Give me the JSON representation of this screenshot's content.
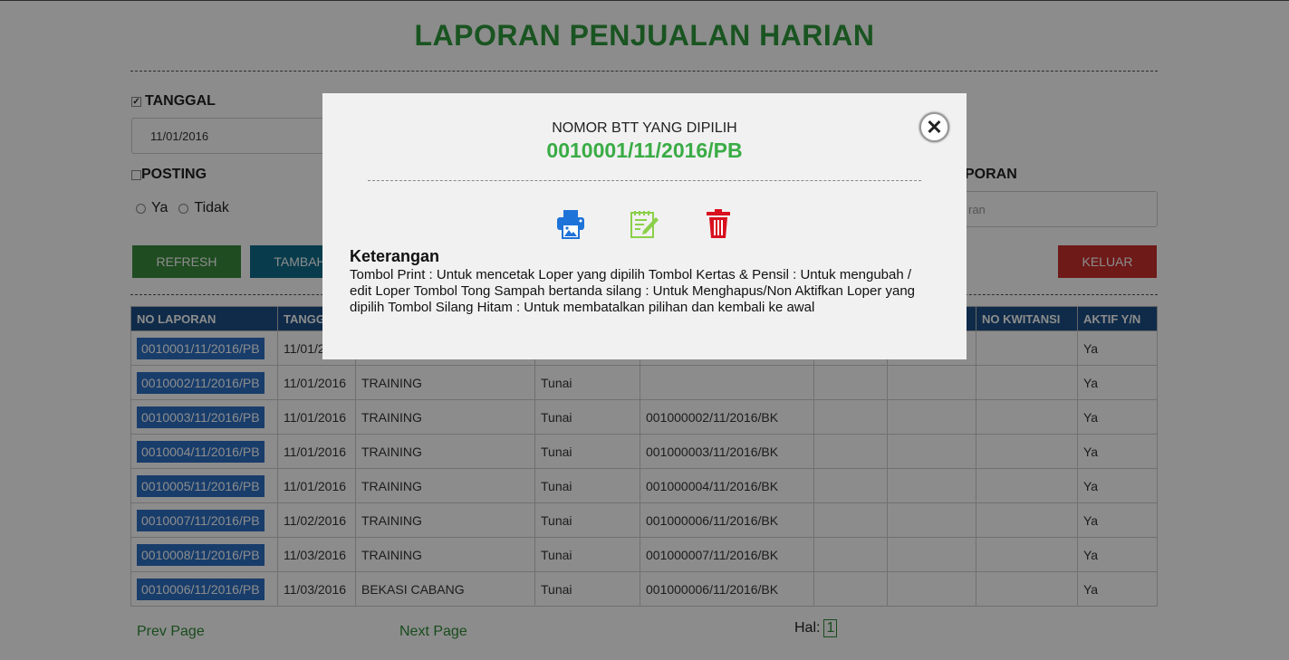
{
  "page": {
    "title": "LAPORAN PENJUALAN HARIAN"
  },
  "filters": {
    "tanggal_label": "TANGGAL",
    "tanggal_checked": true,
    "tanggal_value": "11/01/2016",
    "posting_label": "POSTING",
    "posting_checked": false,
    "radio_ya": "Ya",
    "radio_tidak": "Tidak",
    "laporan_label_partial": "PORAN",
    "laporan_placeholder_partial": "ran"
  },
  "buttons": {
    "refresh": "REFRESH",
    "tambah": "TAMBAH",
    "keluar": "KELUAR"
  },
  "colors": {
    "title_green": "#2e9a3c",
    "header_blue": "#1d4f86",
    "refresh_green": "#3a8a3c",
    "tambah_teal": "#0f6e8c",
    "keluar_red": "#c9302c",
    "link_blue": "#2d6fc4",
    "print_blue": "#1e73d8",
    "edit_green": "#8bd04a",
    "delete_red": "#d9101e"
  },
  "table": {
    "headers": [
      "NO LAPORAN",
      "TANGG",
      "",
      "",
      "",
      "",
      "",
      "NO KWITANSI",
      "AKTIF Y/N"
    ],
    "rows": [
      {
        "no": "0010001/11/2016/PB",
        "tgl": "11/01/2",
        "ket": "",
        "jenis": "",
        "bk": "",
        "aktif": "Ya"
      },
      {
        "no": "0010002/11/2016/PB",
        "tgl": "11/01/2016",
        "ket": "TRAINING",
        "jenis": "Tunai",
        "bk": "",
        "aktif": "Ya"
      },
      {
        "no": "0010003/11/2016/PB",
        "tgl": "11/01/2016",
        "ket": "TRAINING",
        "jenis": "Tunai",
        "bk": "001000002/11/2016/BK",
        "aktif": "Ya"
      },
      {
        "no": "0010004/11/2016/PB",
        "tgl": "11/01/2016",
        "ket": "TRAINING",
        "jenis": "Tunai",
        "bk": "001000003/11/2016/BK",
        "aktif": "Ya"
      },
      {
        "no": "0010005/11/2016/PB",
        "tgl": "11/01/2016",
        "ket": "TRAINING",
        "jenis": "Tunai",
        "bk": "001000004/11/2016/BK",
        "aktif": "Ya"
      },
      {
        "no": "0010007/11/2016/PB",
        "tgl": "11/02/2016",
        "ket": "TRAINING",
        "jenis": "Tunai",
        "bk": "001000006/11/2016/BK",
        "aktif": "Ya"
      },
      {
        "no": "0010008/11/2016/PB",
        "tgl": "11/03/2016",
        "ket": "TRAINING",
        "jenis": "Tunai",
        "bk": "001000007/11/2016/BK",
        "aktif": "Ya"
      },
      {
        "no": "0010006/11/2016/PB",
        "tgl": "11/03/2016",
        "ket": "BEKASI CABANG",
        "jenis": "Tunai",
        "bk": "001000006/11/2016/BK",
        "aktif": "Ya"
      }
    ]
  },
  "pagination": {
    "prev": "Prev Page",
    "next": "Next Page",
    "hal_label": "Hal:",
    "current_page": "1"
  },
  "modal": {
    "heading": "NOMOR BTT YANG DIPILIH",
    "selected_number": "0010001/11/2016/PB",
    "close_icon": "close-icon",
    "print_icon": "print-icon",
    "edit_icon": "edit-icon",
    "delete_icon": "trash-icon",
    "keterangan_title": "Keterangan",
    "keterangan_text": "Tombol Print : Untuk mencetak Loper yang dipilih Tombol Kertas & Pensil : Untuk mengubah / edit Loper Tombol Tong Sampah bertanda silang : Untuk Menghapus/Non Aktifkan Loper yang dipilih Tombol Silang Hitam : Untuk membatalkan pilihan dan kembali ke awal"
  }
}
